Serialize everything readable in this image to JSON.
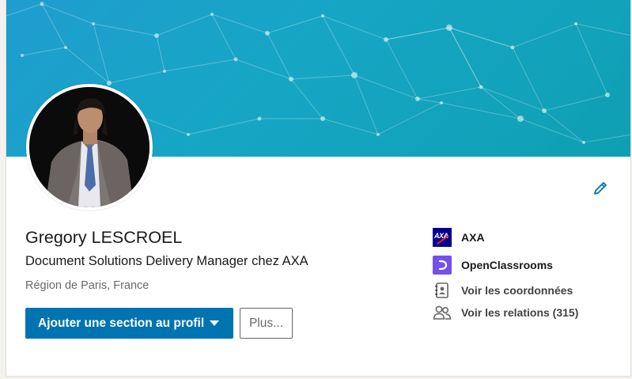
{
  "profile": {
    "name": "Gregory LESCROEL",
    "headline": "Document Solutions Delivery Manager chez AXA",
    "location": "Région de Paris, France"
  },
  "actions": {
    "add_section_label": "Ajouter une section au profil",
    "more_label": "Plus..."
  },
  "sidebar": {
    "company": "AXA",
    "school": "OpenClassrooms",
    "contact_info": "Voir les coordonnées",
    "connections": "Voir les relations (315)"
  },
  "colors": {
    "primary": "#0073b1",
    "axa_blue": "#00008f",
    "axa_red": "#ff1721",
    "openclassrooms": "#7451eb",
    "banner": "#16a6c4"
  },
  "icons": {
    "edit": "pencil-icon",
    "caret": "caret-down-icon",
    "contact": "address-book-icon",
    "connections": "people-icon"
  }
}
